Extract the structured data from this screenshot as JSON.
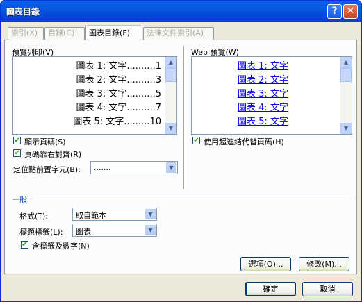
{
  "window": {
    "title": "圖表目錄"
  },
  "titlebar": {
    "help_label": "?",
    "close_label": "✕"
  },
  "tabs": [
    {
      "label": "索引(X)"
    },
    {
      "label": "目錄(C)"
    },
    {
      "label": "圖表目錄(F)"
    },
    {
      "label": "法律文件索引(A)"
    }
  ],
  "print_preview": {
    "label": "預覽列印(V)",
    "lines": [
      "圖表 1: 文字..........1",
      "圖表 2: 文字..........3",
      "圖表 3: 文字..........5",
      "圖表 4: 文字..........7",
      "圖表 5: 文字.........10"
    ]
  },
  "web_preview": {
    "label": "Web 預覽(W)",
    "lines": [
      "圖表 1: 文字",
      "圖表 2: 文字",
      "圖表 3: 文字",
      "圖表 4: 文字",
      "圖表 5: 文字"
    ]
  },
  "options": {
    "show_page_numbers": {
      "label": "顯示頁碼(S)",
      "checked": "✔"
    },
    "right_align": {
      "label": "頁碼靠右對齊(R)",
      "checked": "✔"
    },
    "use_hyperlinks": {
      "label": "使用超連結代替頁碼(H)",
      "checked": "✔"
    },
    "tab_leader": {
      "label": "定位點前置字元(B):",
      "value": "......."
    }
  },
  "general": {
    "heading": "一般",
    "format": {
      "label": "格式(T):",
      "value": "取自範本"
    },
    "caption_label": {
      "label": "標題標籤(L):",
      "value": "圖表"
    },
    "include_label": {
      "label": "含標籤及數字(N)",
      "checked": "✔"
    }
  },
  "buttons": {
    "options": "選項(O)...",
    "modify": "修改(M)...",
    "ok": "確定",
    "cancel": "取消"
  }
}
